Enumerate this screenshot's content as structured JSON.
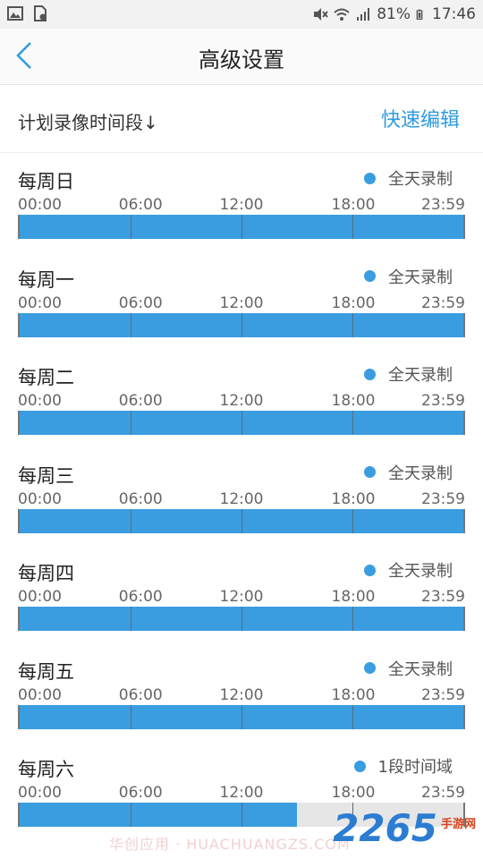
{
  "status_bar": {
    "battery": "81%",
    "time": "17:46"
  },
  "nav": {
    "title": "高级设置"
  },
  "section": {
    "title": "计划录像时间段↓",
    "quick_edit": "快速编辑"
  },
  "ticks": [
    "00:00",
    "06:00",
    "12:00",
    "18:00",
    "23:59"
  ],
  "days": [
    {
      "name": "每周日",
      "status": "全天录制",
      "fill": 1.0
    },
    {
      "name": "每周一",
      "status": "全天录制",
      "fill": 1.0
    },
    {
      "name": "每周二",
      "status": "全天录制",
      "fill": 1.0
    },
    {
      "name": "每周三",
      "status": "全天录制",
      "fill": 1.0
    },
    {
      "name": "每周四",
      "status": "全天录制",
      "fill": 1.0
    },
    {
      "name": "每周五",
      "status": "全天录制",
      "fill": 1.0
    },
    {
      "name": "每周六",
      "status": "1段时间域",
      "fill": 0.625
    }
  ],
  "watermark": {
    "site_text": "华创应用 · HUACHUANGZS.COM",
    "logo_number": "2265",
    "logo_suffix": "手游网"
  },
  "colors": {
    "accent": "#3a9de0",
    "link": "#2f9be0"
  }
}
